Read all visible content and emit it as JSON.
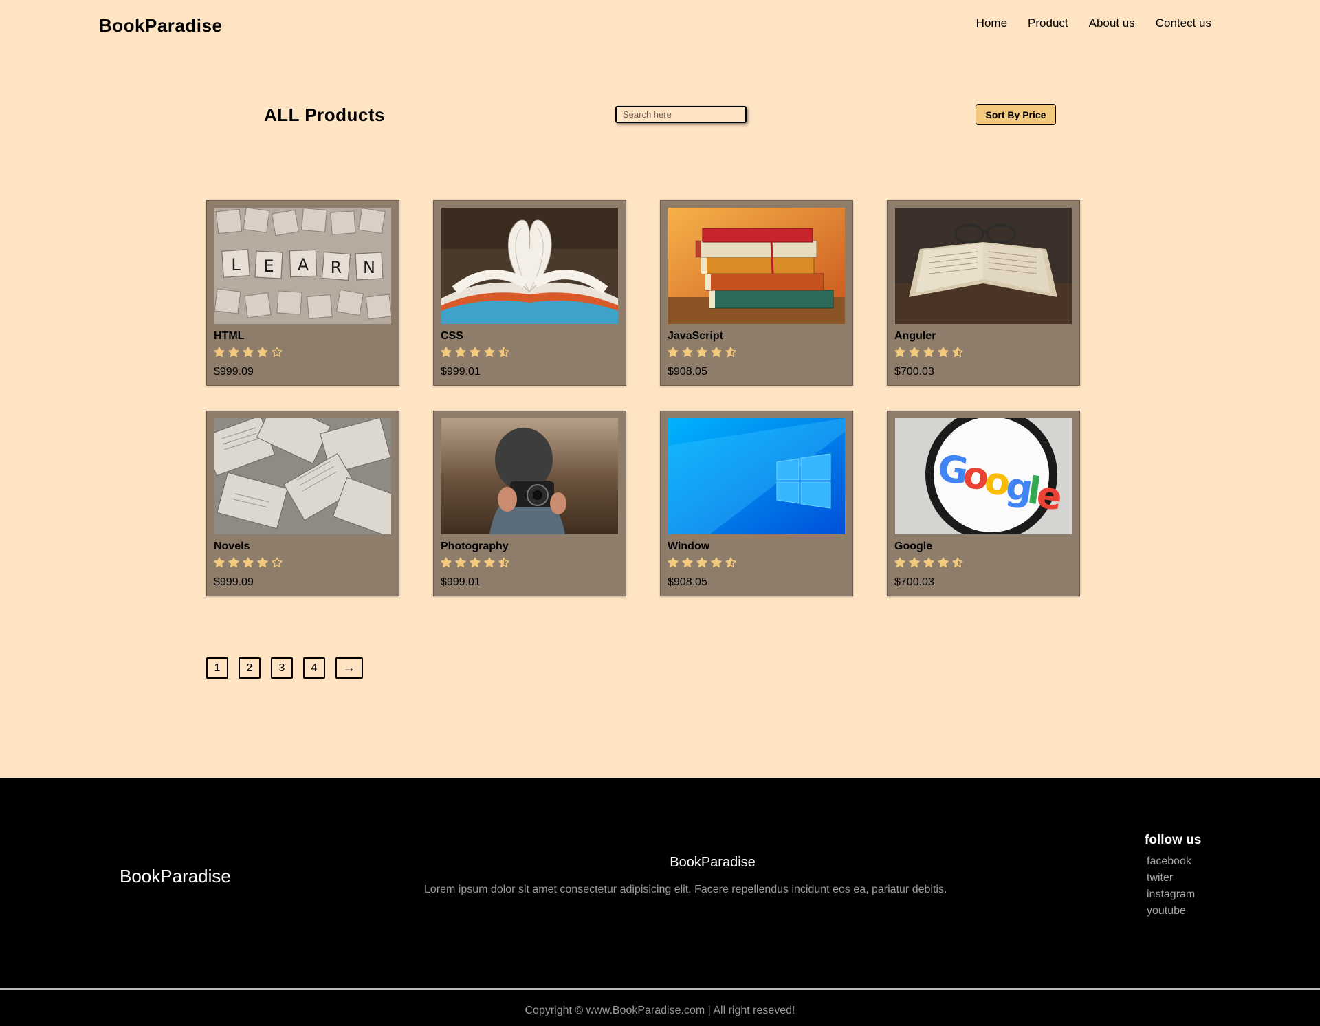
{
  "brand": "BookParadise",
  "nav": {
    "items": [
      "Home",
      "Product",
      "About us",
      "Contect us"
    ]
  },
  "toolbar": {
    "heading": "ALL Products",
    "search_placeholder": "Search here",
    "sort_label": "Sort By Price"
  },
  "products": [
    {
      "title": "HTML",
      "rating": 4.0,
      "price": "$999.09",
      "image": "scrabble-learn-tiles"
    },
    {
      "title": "CSS",
      "rating": 4.5,
      "price": "$999.01",
      "image": "heart-shaped-book-pages"
    },
    {
      "title": "JavaScript",
      "rating": 4.5,
      "price": "$908.05",
      "image": "stack-of-books"
    },
    {
      "title": "Anguler",
      "rating": 4.5,
      "price": "$700.03",
      "image": "open-book-with-glasses"
    },
    {
      "title": "Novels",
      "rating": 4.0,
      "price": "$999.09",
      "image": "scattered-open-books"
    },
    {
      "title": "Photography",
      "rating": 4.5,
      "price": "$999.01",
      "image": "person-with-camera"
    },
    {
      "title": "Window",
      "rating": 4.5,
      "price": "$908.05",
      "image": "windows-logo-wallpaper"
    },
    {
      "title": "Google",
      "rating": 4.5,
      "price": "$700.03",
      "image": "google-logo-magnifier"
    }
  ],
  "pagination": {
    "pages": [
      "1",
      "2",
      "3",
      "4"
    ],
    "next": "→"
  },
  "footer": {
    "brand": "BookParadise",
    "center_title": "BookParadise",
    "description": "Lorem ipsum dolor sit amet consectetur adipisicing elit. Facere repellendus incidunt eos ea, pariatur debitis.",
    "follow_title": "follow us",
    "social": [
      "facebook",
      "twiter",
      "instagram",
      "youtube"
    ],
    "copyright": "Copyright © www.BookParadise.com | All right reseved!"
  },
  "colors": {
    "page_bg": "#ffe4c4",
    "card_bg": "#8f7d6c",
    "star": "#f3ca7e",
    "button_bg": "#f3ca7e",
    "footer_bg": "#000000"
  }
}
